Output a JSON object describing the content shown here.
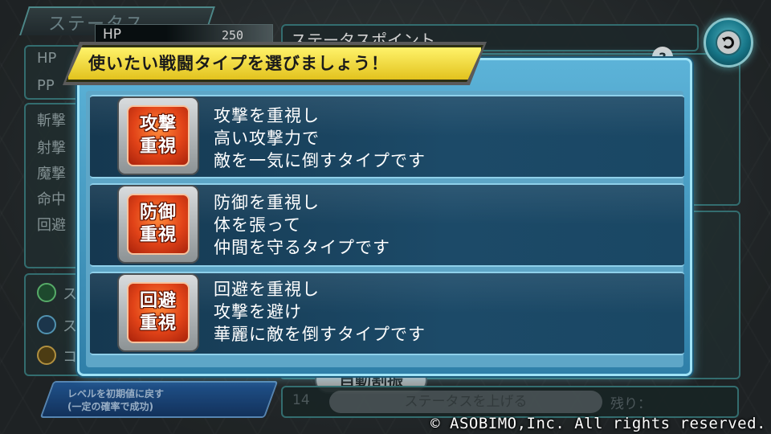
{
  "background": {
    "tab_label": "ステータス",
    "hp_label": "HP",
    "hp_value": "250",
    "stat_labels": [
      "HP",
      "PP",
      "斬撃",
      "射撃",
      "魔撃",
      "命中",
      "回避"
    ],
    "points_title": "ステータスポイント",
    "help_label": "?",
    "row_letters": [
      "ス",
      "ス",
      "コ"
    ],
    "auto_button_label": "自動割振",
    "reset_button_label": "レベルを初期値に戻す",
    "reset_button_sub": "(一定の確率で成功)",
    "count_text": "14",
    "raise_button_label": "ステータスを上げる",
    "remaining_text": "残り："
  },
  "dialog": {
    "title": "使いたい戦闘タイプを選びましょう！",
    "options": [
      {
        "icon_lines": [
          "攻撃",
          "重視"
        ],
        "desc": [
          "攻撃を重視し",
          "高い攻撃力で",
          "敵を一気に倒すタイプです"
        ]
      },
      {
        "icon_lines": [
          "防御",
          "重視"
        ],
        "desc": [
          "防御を重視し",
          "体を張って",
          "仲間を守るタイプです"
        ]
      },
      {
        "icon_lines": [
          "回避",
          "重視"
        ],
        "desc": [
          "回避を重視し",
          "攻撃を避け",
          "華麗に敵を倒すタイプです"
        ]
      }
    ]
  },
  "copyright": "© ASOBIMO,Inc. All rights reserved."
}
